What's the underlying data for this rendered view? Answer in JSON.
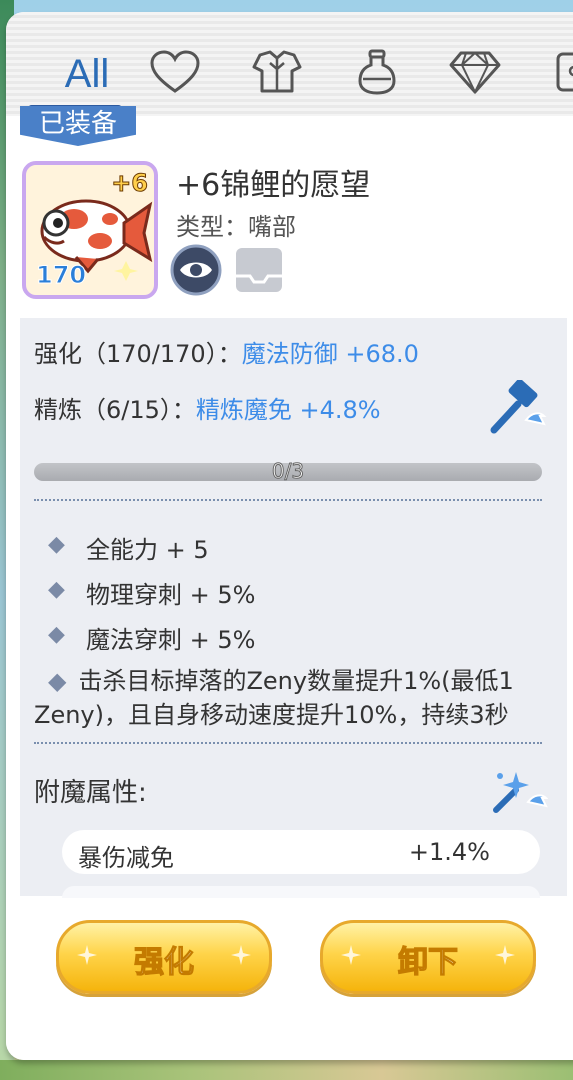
{
  "tabs": [
    {
      "label": "All",
      "icon": null
    },
    {
      "label": "",
      "icon": "heart-icon"
    },
    {
      "label": "",
      "icon": "armor-icon"
    },
    {
      "label": "",
      "icon": "potion-icon"
    },
    {
      "label": "",
      "icon": "gem-icon"
    },
    {
      "label": "",
      "icon": "card-icon"
    }
  ],
  "item": {
    "equipped_label": "已装备",
    "refine_badge": "+6",
    "level": "170",
    "name": "+6锦鲤的愿望",
    "type": "类型：嘴部",
    "frame_color": "#c9a7ef"
  },
  "stats": {
    "strengthen_label": "强化（170/170）：",
    "strengthen_value": "魔法防御 +68.0",
    "refine_label": "精炼（6/15）：",
    "refine_value": "精炼魔免 +4.8%",
    "progress_text": "0/3",
    "progress_fraction": 0
  },
  "attributes": [
    "全能力 + 5",
    "物理穿刺 + 5%",
    "魔法穿刺 + 5%"
  ],
  "special_effect": "击杀目标掉落的Zeny数量提升1%(最低1 Zeny)，且自身移动速度提升10%，持续3秒",
  "bullet_glyph": "◆",
  "enchant": {
    "title": "附魔属性:",
    "rows": [
      {
        "name": "暴伤减免",
        "value": "+1.4%"
      }
    ]
  },
  "buttons": {
    "strengthen": "强化",
    "unequip": "卸下"
  },
  "colors": {
    "accent_blue": "#3d8ce8",
    "tab_active": "#2b6cb6",
    "button_gold": "#ffd44a"
  }
}
